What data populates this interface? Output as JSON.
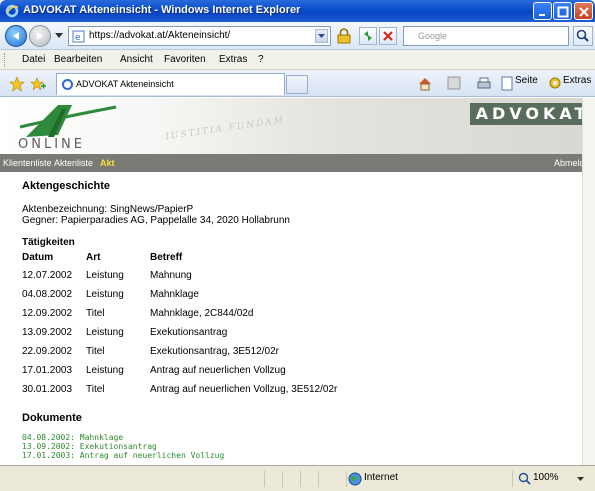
{
  "window": {
    "title": "ADVOKAT Akteneinsicht - Windows Internet Explorer"
  },
  "address": {
    "url": "https://advokat.at/Akteneinsicht/",
    "search_placeholder": "Google"
  },
  "menu": [
    "Datei",
    "Bearbeiten",
    "Ansicht",
    "Favoriten",
    "Extras",
    "?"
  ],
  "tab": {
    "label": "ADVOKAT Akteneinsicht"
  },
  "toolbar": {
    "page_label": "Seite",
    "tools_label": "Extras"
  },
  "site": {
    "logo_text": "ONLINE",
    "brand": "ADVOKAT",
    "watermark": "IUSTITIA FUNDAM"
  },
  "nav": {
    "items": [
      "Klientenliste",
      "Aktenliste",
      "Akt"
    ],
    "logout": "Abmelden"
  },
  "akt": {
    "heading": "Aktengeschichte",
    "bezeichnung": "Aktenbezeichnung: SingNews/PapierP",
    "gegner": "Gegner: Papierparadies AG, Pappelalle 34, 2020 Hollabrunn",
    "taetigkeiten_heading": "Tätigkeiten",
    "columns": [
      "Datum",
      "Art",
      "Betreff"
    ],
    "rows": [
      [
        "12.07.2002",
        "Leistung",
        "Mahnung"
      ],
      [
        "04.08.2002",
        "Leistung",
        "Mahnklage"
      ],
      [
        "12.09.2002",
        "Titel",
        "Mahnklage, 2C844/02d"
      ],
      [
        "13.09.2002",
        "Leistung",
        "Exekutionsantrag"
      ],
      [
        "22.09.2002",
        "Titel",
        "Exekutionsantrag, 3E512/02r"
      ],
      [
        "17.01.2003",
        "Leistung",
        "Antrag auf neuerlichen Vollzug"
      ],
      [
        "30.01.2003",
        "Titel",
        "Antrag auf neuerlichen Vollzug, 3E512/02r"
      ]
    ],
    "dokumente_heading": "Dokumente",
    "dokumente": [
      "04.08.2002: Mahnklage",
      "13.09.2002: Exekutionsantrag",
      "17.01.2003: Antrag auf neuerlichen Vollzug"
    ]
  },
  "status": {
    "zone": "Internet",
    "zoom": "100%"
  }
}
